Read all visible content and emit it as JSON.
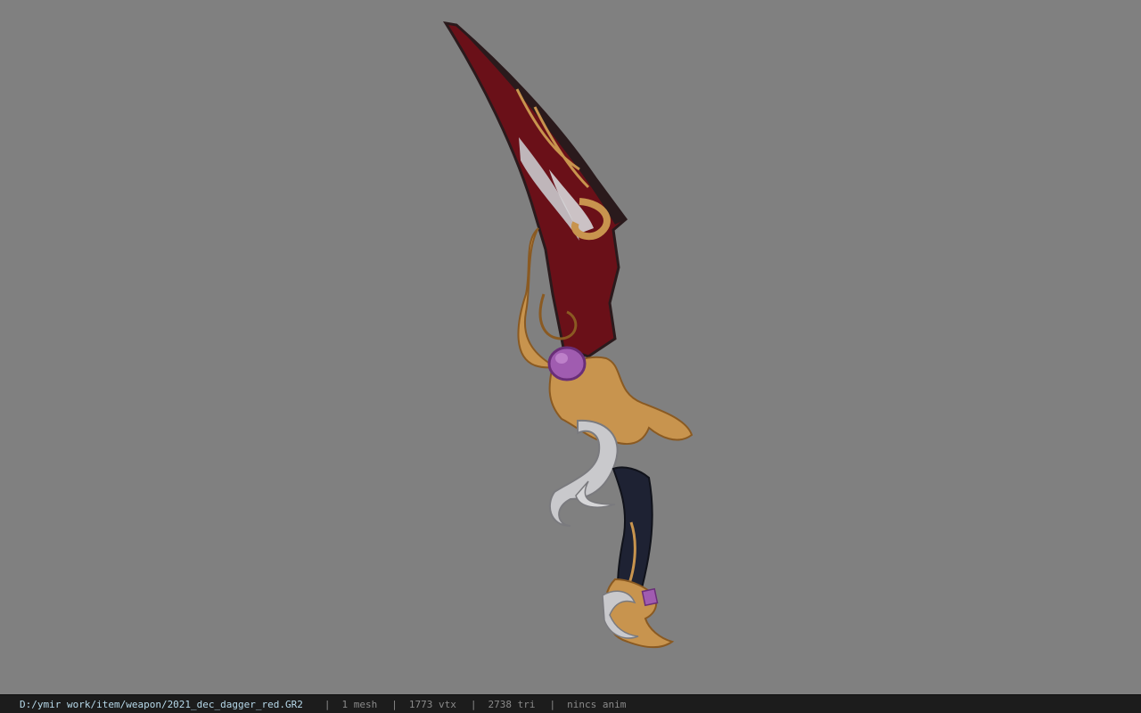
{
  "viewport": {
    "background_color": "#808080",
    "model": {
      "icon": "curved-dagger-model",
      "colors": {
        "blade_red": "#6a1018",
        "blade_dark": "#2a1a1c",
        "gold": "#c8944e",
        "gold_dark": "#8a5a22",
        "silver": "#c9c9cc",
        "gem_purple": "#a05cb0",
        "grip_navy": "#1e2233"
      }
    }
  },
  "status_bar": {
    "file_path": "D:/ymir work/item/weapon/2021_dec_dagger_red.GR2",
    "separator": "|",
    "mesh_count": "1 mesh",
    "vertex_count": "1773 vtx",
    "triangle_count": "2738 tri",
    "animation": "nincs anim"
  }
}
